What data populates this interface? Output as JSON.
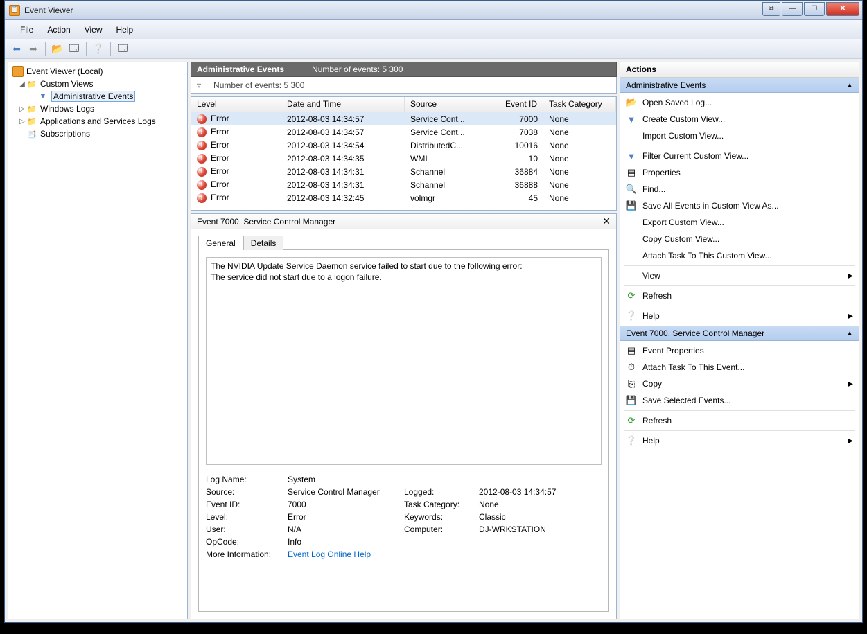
{
  "window": {
    "title": "Event Viewer"
  },
  "menubar": {
    "file": "File",
    "action": "Action",
    "view": "View",
    "help": "Help"
  },
  "tree": {
    "root": "Event Viewer (Local)",
    "custom_views": "Custom Views",
    "admin_events": "Administrative Events",
    "windows_logs": "Windows Logs",
    "app_services": "Applications and Services Logs",
    "subscriptions": "Subscriptions"
  },
  "mid": {
    "header_title": "Administrative Events",
    "header_count": "Number of events: 5 300",
    "filter_count": "Number of events: 5 300"
  },
  "columns": {
    "level": "Level",
    "date": "Date and Time",
    "source": "Source",
    "id": "Event ID",
    "task": "Task Category"
  },
  "events": [
    {
      "level": "Error",
      "date": "2012-08-03 14:34:57",
      "source": "Service Cont...",
      "id": "7000",
      "task": "None"
    },
    {
      "level": "Error",
      "date": "2012-08-03 14:34:57",
      "source": "Service Cont...",
      "id": "7038",
      "task": "None"
    },
    {
      "level": "Error",
      "date": "2012-08-03 14:34:54",
      "source": "DistributedC...",
      "id": "10016",
      "task": "None"
    },
    {
      "level": "Error",
      "date": "2012-08-03 14:34:35",
      "source": "WMI",
      "id": "10",
      "task": "None"
    },
    {
      "level": "Error",
      "date": "2012-08-03 14:34:31",
      "source": "Schannel",
      "id": "36884",
      "task": "None"
    },
    {
      "level": "Error",
      "date": "2012-08-03 14:34:31",
      "source": "Schannel",
      "id": "36888",
      "task": "None"
    },
    {
      "level": "Error",
      "date": "2012-08-03 14:32:45",
      "source": "volmgr",
      "id": "45",
      "task": "None"
    }
  ],
  "detail": {
    "title": "Event 7000, Service Control Manager",
    "tab_general": "General",
    "tab_details": "Details",
    "message_line1": "The NVIDIA Update Service Daemon service failed to start due to the following error:",
    "message_line2": "The service did not start due to a logon failure.",
    "labels": {
      "logname": "Log Name:",
      "source": "Source:",
      "eventid": "Event ID:",
      "level": "Level:",
      "user": "User:",
      "opcode": "OpCode:",
      "moreinfo": "More Information:",
      "logged": "Logged:",
      "taskcat": "Task Category:",
      "keywords": "Keywords:",
      "computer": "Computer:"
    },
    "values": {
      "logname": "System",
      "source": "Service Control Manager",
      "eventid": "7000",
      "level": "Error",
      "user": "N/A",
      "opcode": "Info",
      "moreinfo": "Event Log Online Help",
      "logged": "2012-08-03 14:34:57",
      "taskcat": "None",
      "keywords": "Classic",
      "computer": "DJ-WRKSTATION"
    }
  },
  "actions": {
    "header": "Actions",
    "section1": "Administrative Events",
    "section2": "Event 7000, Service Control Manager",
    "items1": {
      "open_saved": "Open Saved Log...",
      "create_view": "Create Custom View...",
      "import_view": "Import Custom View...",
      "filter_view": "Filter Current Custom View...",
      "properties": "Properties",
      "find": "Find...",
      "save_all": "Save All Events in Custom View As...",
      "export_view": "Export Custom View...",
      "copy_view": "Copy Custom View...",
      "attach_task": "Attach Task To This Custom View...",
      "view": "View",
      "refresh": "Refresh",
      "help": "Help"
    },
    "items2": {
      "event_props": "Event Properties",
      "attach_event": "Attach Task To This Event...",
      "copy": "Copy",
      "save_sel": "Save Selected Events...",
      "refresh": "Refresh",
      "help": "Help"
    }
  }
}
